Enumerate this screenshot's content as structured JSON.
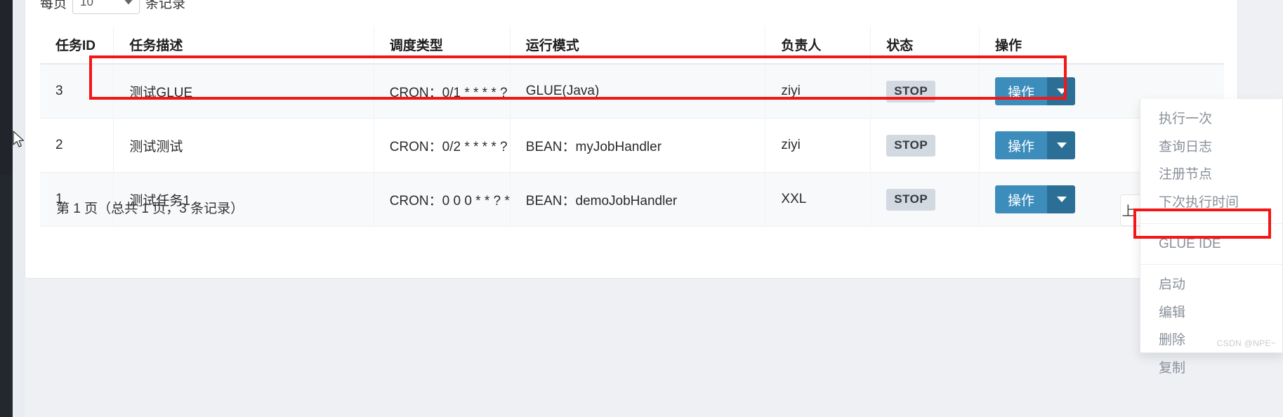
{
  "toolbar": {
    "length_prefix": "每页",
    "length_value": "10",
    "length_suffix": "条记录",
    "select_icon": "chevron-down-icon"
  },
  "table": {
    "columns": [
      {
        "key": "id",
        "label": "任务ID"
      },
      {
        "key": "desc",
        "label": "任务描述"
      },
      {
        "key": "sched",
        "label": "调度类型"
      },
      {
        "key": "mode",
        "label": "运行模式"
      },
      {
        "key": "owner",
        "label": "负责人"
      },
      {
        "key": "state",
        "label": "状态"
      },
      {
        "key": "ops",
        "label": "操作"
      }
    ],
    "rows": [
      {
        "id": "3",
        "desc": "测试GLUE",
        "sched": "CRON：0/1 * * * * ?",
        "mode": "GLUE(Java)",
        "owner": "ziyi",
        "state": "STOP",
        "action_label": "操作",
        "action_caret_icon": "caret-down-icon"
      },
      {
        "id": "2",
        "desc": "测试测试",
        "sched": "CRON：0/2 * * * * ?",
        "mode": "BEAN：myJobHandler",
        "owner": "ziyi",
        "state": "STOP",
        "action_label": "操作",
        "action_caret_icon": "caret-down-icon"
      },
      {
        "id": "1",
        "desc": "测试任务1",
        "sched": "CRON：0 0 0 * * ? *",
        "mode": "BEAN：demoJobHandler",
        "owner": "XXL",
        "state": "STOP",
        "action_label": "操作",
        "action_caret_icon": "caret-down-icon"
      }
    ]
  },
  "footer": {
    "info": "第 1 页（总共 1 页，3 条记录）",
    "prev_label": "上一页"
  },
  "dropdown": {
    "group1": [
      "执行一次",
      "查询日志",
      "注册节点",
      "下次执行时间"
    ],
    "group2": [
      "GLUE IDE"
    ],
    "group3": [
      "启动",
      "编辑",
      "删除",
      "复制"
    ]
  },
  "watermark": "CSDN @NPE~",
  "colors": {
    "accent": "#3c8dbc",
    "accent_dark": "#2b6f97",
    "annotation": "#f41616",
    "badge_bg": "#d3d9e0"
  }
}
